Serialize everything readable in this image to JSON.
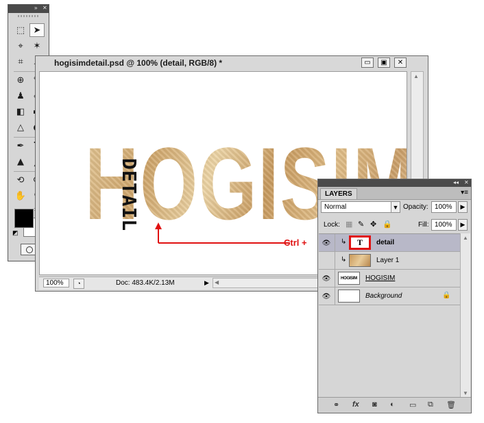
{
  "tools_panel": {
    "collapse_glyph": "»",
    "close_glyph": "✕",
    "tools": [
      {
        "name": "marquee-tool-icon",
        "glyph": "⬚"
      },
      {
        "name": "move-tool-icon",
        "glyph": "➤"
      },
      {
        "name": "lasso-tool-icon",
        "glyph": "⌖"
      },
      {
        "name": "magic-wand-tool-icon",
        "glyph": "✶"
      },
      {
        "name": "crop-tool-icon",
        "glyph": "⌗"
      },
      {
        "name": "eyedropper-tool-icon",
        "glyph": "⟋"
      },
      {
        "name": "healing-brush-tool-icon",
        "glyph": "⊕"
      },
      {
        "name": "brush-tool-icon",
        "glyph": "✎"
      },
      {
        "name": "clone-stamp-tool-icon",
        "glyph": "♟"
      },
      {
        "name": "history-brush-tool-icon",
        "glyph": "✐"
      },
      {
        "name": "eraser-tool-icon",
        "glyph": "◧"
      },
      {
        "name": "gradient-tool-icon",
        "glyph": "▬"
      },
      {
        "name": "blur-tool-icon",
        "glyph": "△"
      },
      {
        "name": "dodge-tool-icon",
        "glyph": "●"
      },
      {
        "name": "pen-tool-icon",
        "glyph": "✒"
      },
      {
        "name": "type-tool-icon",
        "glyph": "T"
      },
      {
        "name": "path-selection-tool-icon",
        "glyph": "▲"
      },
      {
        "name": "line-tool-icon",
        "glyph": "╱"
      },
      {
        "name": "3d-rotate-tool-icon",
        "glyph": "⟲"
      },
      {
        "name": "3d-orbit-tool-icon",
        "glyph": "⟳"
      },
      {
        "name": "hand-tool-icon",
        "glyph": "✋"
      },
      {
        "name": "zoom-tool-icon",
        "glyph": "⚲"
      }
    ],
    "foreground_color": "#000000",
    "background_color": "#ffffff"
  },
  "document": {
    "title": "hogisimdetail.psd @ 100% (detail, RGB/8) *",
    "minimize_glyph": "▭",
    "maximize_glyph": "▣",
    "close_glyph": "✕",
    "canvas_text": "HOGISIM",
    "overlay_text": "DETAIL",
    "annotation": "Ctrl +",
    "annotation_color": "#e01010",
    "zoom": "100%",
    "doc_info": "Doc: 483.4K/2.13M",
    "status_arrow": "▶",
    "scroll_left": "◀"
  },
  "layers_panel": {
    "collapse_glyph": "◂◂",
    "close_glyph": "✕",
    "tab_label": "LAYERS",
    "menu_glyph": "▾≡",
    "blend_mode": "Normal",
    "opacity_label": "Opacity:",
    "opacity_value": "100%",
    "lock_label": "Lock:",
    "fill_label": "Fill:",
    "fill_value": "100%",
    "layers": [
      {
        "name": "detail",
        "thumb": "T",
        "selected": true
      },
      {
        "name": "Layer 1",
        "thumb": "",
        "selected": false
      },
      {
        "name": "HOGISIM",
        "thumb": "HOGISIM",
        "selected": false
      },
      {
        "name": "Background",
        "thumb": "",
        "selected": false
      }
    ],
    "bottom_icons": [
      "link-layers-icon",
      "fx-icon",
      "layer-mask-icon",
      "adjustment-layer-icon",
      "group-folder-icon",
      "new-layer-icon",
      "trash-icon"
    ],
    "bottom_glyphs": [
      "⚭",
      "fx",
      "◙",
      "◐",
      "▭",
      "⧉",
      "🗑"
    ]
  }
}
